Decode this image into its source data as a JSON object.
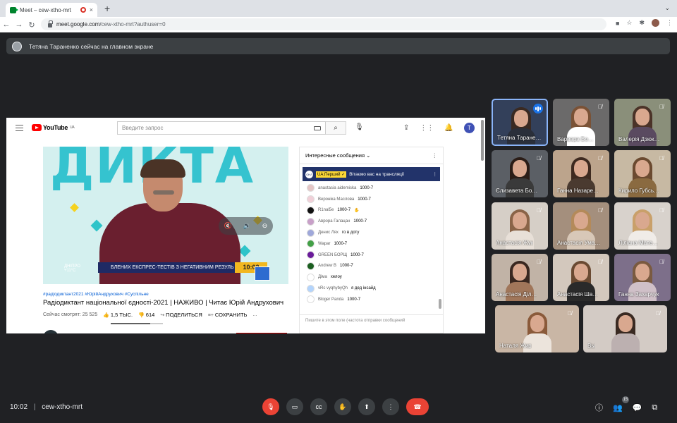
{
  "browser": {
    "tab_title": "Meet – cew-xtho-mrt",
    "tab_close": "×",
    "new_tab": "+",
    "url_host": "meet.google.com",
    "url_path": "/cew-xtho-mrt?authuser=0",
    "back": "←",
    "forward": "→",
    "reload": "↻",
    "tab_dropdown": "⌄"
  },
  "banner": {
    "text": "Тетяна Тараненко сейчас на главном экране"
  },
  "youtube": {
    "logo": "YouTube",
    "region": "UA",
    "search_placeholder": "Введите запрос",
    "avatar_letter": "T",
    "video": {
      "big_text": "ДИКТА",
      "ticker": "БЛЕНИХ ЕКСПРЕС-ТЕСТІВ З НЕГАТИВНИМ РЕЗУЛЬ",
      "clock": "10:02",
      "weather_city": "ДНІПРО",
      "weather_temp": "+11°C"
    },
    "tags": "#радіодиктант2021 #ЮрійАндрухович #Суспільне",
    "title": "Радіодиктант національної єдності-2021 | НАЖИВО | Читає Юрій Андрухович",
    "viewers": "Сейчас смотрят: 25 525",
    "likes": "1,5 ТЫС.",
    "dislikes": "614",
    "share": "ПОДЕЛИТЬСЯ",
    "save": "СОХРАНИТЬ",
    "more": "..."
  },
  "chat": {
    "mode": "Интересные сообщения",
    "pinned": {
      "avatar": "ОНЛ",
      "author": "UA:Перший",
      "text": "Вітаємо вас на трансляції"
    },
    "messages": [
      {
        "author": "anastasia aidemiska",
        "text": "1000-7",
        "color": "#e4c5c5"
      },
      {
        "author": "Вероніка Маслова",
        "text": "1000-7",
        "color": "#f0d0d8"
      },
      {
        "author": "R1nal5e",
        "text": "1000-7",
        "color": "#111111",
        "emoji": "✋"
      },
      {
        "author": "Аврора Галацан",
        "text": "1000-7",
        "color": "#c8a0c8"
      },
      {
        "author": "Денис Лях",
        "text": "го в доту",
        "color": "#9fa8da"
      },
      {
        "author": "Wapar",
        "text": "1000-7",
        "color": "#43a047"
      },
      {
        "author": "GREEN БОРЩ",
        "text": "1000-7",
        "color": "#6a1b9a"
      },
      {
        "author": "Andrew B",
        "text": "1000-7",
        "color": "#1b5e20"
      },
      {
        "author": "Діма",
        "text": "хелоу",
        "color": "#ffffff"
      },
      {
        "author": "vRc vyqhybyQh",
        "text": "я дед інсайд",
        "color": "#b3d4fc"
      },
      {
        "author": "Bloger Panda",
        "text": "1000-7",
        "color": "#ffffff"
      }
    ],
    "input_placeholder": "Пишите в этом поле (частота отправки сообщений"
  },
  "participants": [
    {
      "name": "Тетяна Таране…",
      "muted": false,
      "speaking": true,
      "bg": "#33405a",
      "hair": "#3a2a22",
      "shirt": "#2a2f3a"
    },
    {
      "name": "Варвара Бо…",
      "muted": true,
      "bg": "#6b6a6a",
      "hair": "#7a5236",
      "shirt": "#ffffff"
    },
    {
      "name": "Валерія Дзюк…",
      "muted": true,
      "bg": "#8a8f7a",
      "hair": "#4b3328",
      "shirt": "#5a4a60"
    },
    {
      "name": "Єлизавета Бо…",
      "muted": true,
      "bg": "#5b5f65",
      "hair": "#2b1d17",
      "shirt": "#3a3a3a"
    },
    {
      "name": "Ганна Назаре…",
      "muted": true,
      "bg": "#bca48c",
      "hair": "#3e2a20",
      "shirt": "#4a3a30"
    },
    {
      "name": "Кирило Губсь…",
      "muted": true,
      "bg": "#c7b9a3",
      "hair": "#6b4a30",
      "shirt": "#8a6a40"
    },
    {
      "name": "Анастасія Жук",
      "muted": true,
      "bg": "#d6cfc7",
      "hair": "#8a6448",
      "shirt": "#e8e0d8"
    },
    {
      "name": "Анастасія Ума…",
      "muted": true,
      "bg": "#a48f7d",
      "hair": "#b48a5a",
      "shirt": "#d8c8b8"
    },
    {
      "name": "Ліліана Мате…",
      "muted": true,
      "bg": "#d8d2cc",
      "hair": "#c9a06a",
      "shirt": "#f0ece8"
    },
    {
      "name": "Анастасія Діл…",
      "muted": true,
      "bg": "#c1b3a6",
      "hair": "#3a2820",
      "shirt": "#a0765a"
    },
    {
      "name": "Анастасія Ша…",
      "muted": true,
      "bg": "#d3c8bd",
      "hair": "#6a4a32",
      "shirt": "#2a2a2a"
    },
    {
      "name": "Ганна Захарчук",
      "muted": true,
      "bg": "#7d6f8a",
      "hair": "#7a5a40",
      "shirt": "#d0c0c8"
    },
    {
      "name": "Наталя Жир",
      "muted": true,
      "bg": "#c9b6a5",
      "hair": "#8a5a3a",
      "shirt": "#ece4dc"
    },
    {
      "name": "Вы",
      "muted": true,
      "bg": "#d3cbc5",
      "hair": "#3a2a22",
      "shirt": "#bcb0b0"
    }
  ],
  "meeting": {
    "time": "10:02",
    "separator": "|",
    "code": "cew-xtho-mrt",
    "participant_count": "15"
  },
  "colors": {
    "accent": "#8ab4f8",
    "end_call": "#ea4335",
    "background": "#202124"
  }
}
